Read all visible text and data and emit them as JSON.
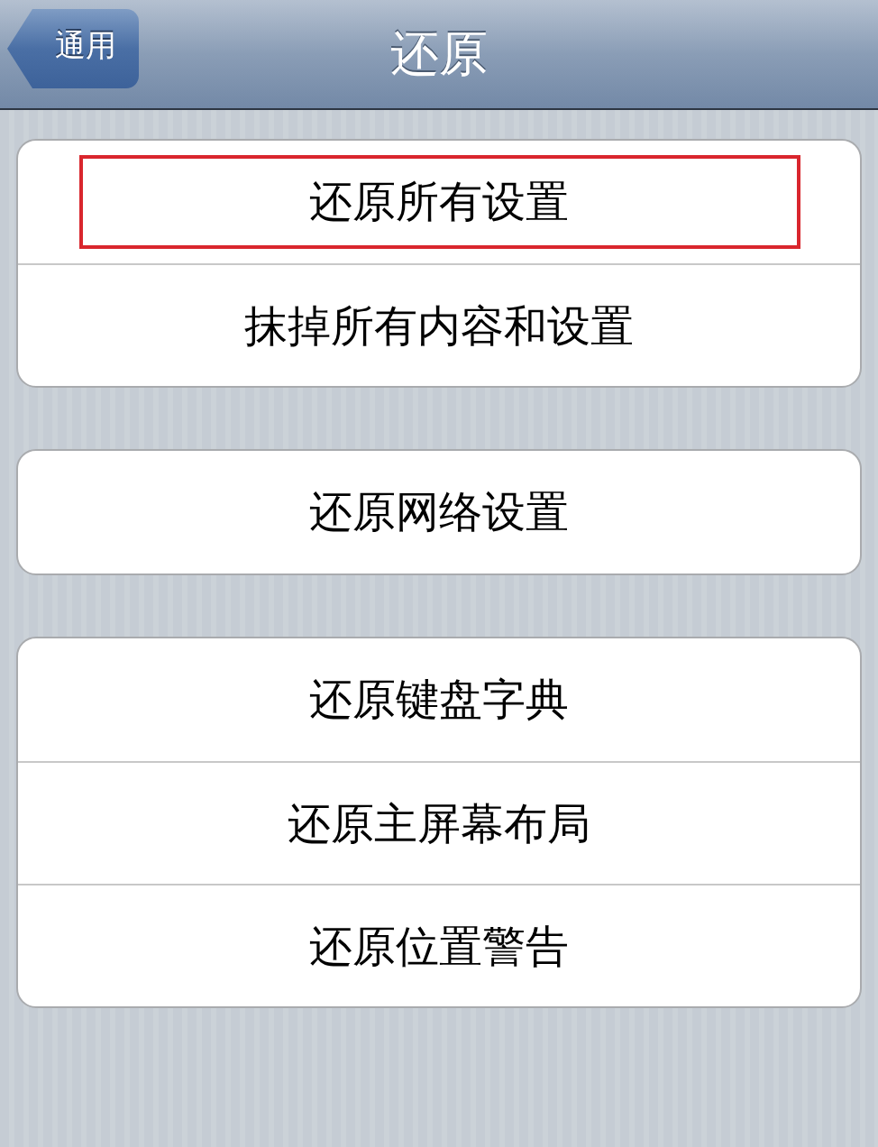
{
  "nav_bar": {
    "back_button": "通用",
    "title": "还原"
  },
  "groups": [
    {
      "items": [
        {
          "label": "还原所有设置",
          "highlighted": true
        },
        {
          "label": "抹掉所有内容和设置",
          "highlighted": false
        }
      ]
    },
    {
      "items": [
        {
          "label": "还原网络设置",
          "highlighted": false
        }
      ]
    },
    {
      "items": [
        {
          "label": "还原键盘字典",
          "highlighted": false
        },
        {
          "label": "还原主屏幕布局",
          "highlighted": false
        },
        {
          "label": "还原位置警告",
          "highlighted": false
        }
      ]
    }
  ]
}
